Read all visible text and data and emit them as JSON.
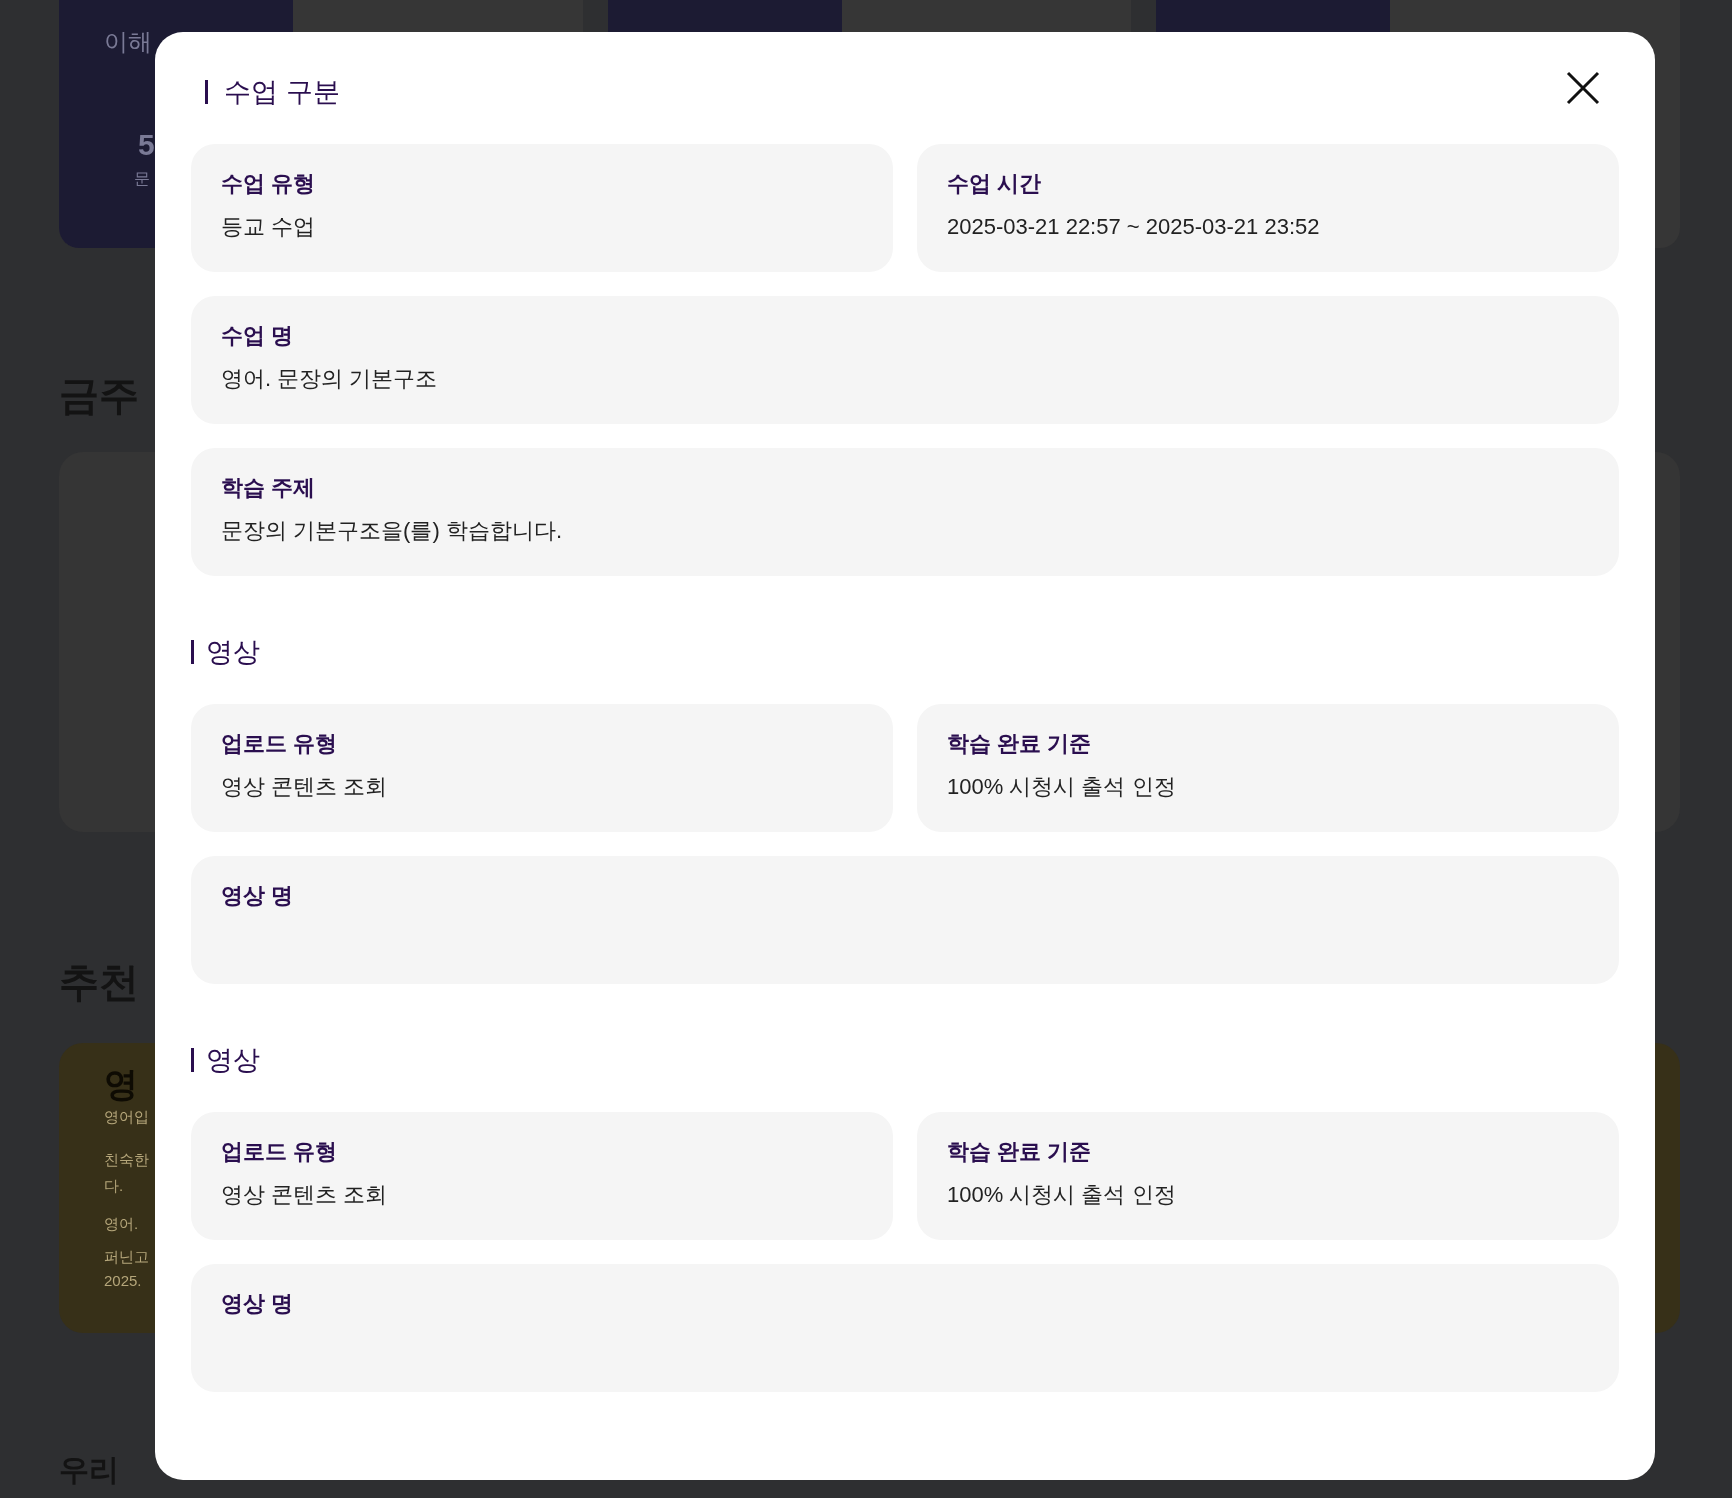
{
  "background": {
    "top_card": {
      "subtitle": "이해",
      "count": "5",
      "caption": "문"
    },
    "sections": [
      {
        "title": "금주"
      },
      {
        "title": "추천"
      }
    ],
    "recommend_card": {
      "title": "영",
      "subtitle": "영어입",
      "description_1": "친숙한",
      "description_2": "다.",
      "course": "영어.",
      "teacher": "퍼닌고",
      "date": "2025."
    },
    "bottom_title": "우리"
  },
  "modal": {
    "sections": [
      {
        "title": "수업 구분",
        "rows": [
          [
            {
              "label": "수업 유형",
              "value": "등교 수업"
            },
            {
              "label": "수업 시간",
              "value": "2025-03-21 22:57 ~ 2025-03-21 23:52"
            }
          ],
          [
            {
              "label": "수업 명",
              "value": "영어. 문장의 기본구조"
            }
          ],
          [
            {
              "label": "학습 주제",
              "value": "문장의 기본구조을(를) 학습합니다."
            }
          ]
        ]
      },
      {
        "title": "영상",
        "rows": [
          [
            {
              "label": "업로드 유형",
              "value": "영상 콘텐츠 조회"
            },
            {
              "label": "학습 완료 기준",
              "value": "100% 시청시 출석 인정"
            }
          ],
          [
            {
              "label": "영상 명"
            }
          ]
        ]
      },
      {
        "title": "영상",
        "rows": [
          [
            {
              "label": "업로드 유형",
              "value": "영상 콘텐츠 조회"
            },
            {
              "label": "학습 완료 기준",
              "value": "100% 시청시 출석 인정"
            }
          ],
          [
            {
              "label": "영상 명"
            }
          ]
        ]
      }
    ]
  }
}
